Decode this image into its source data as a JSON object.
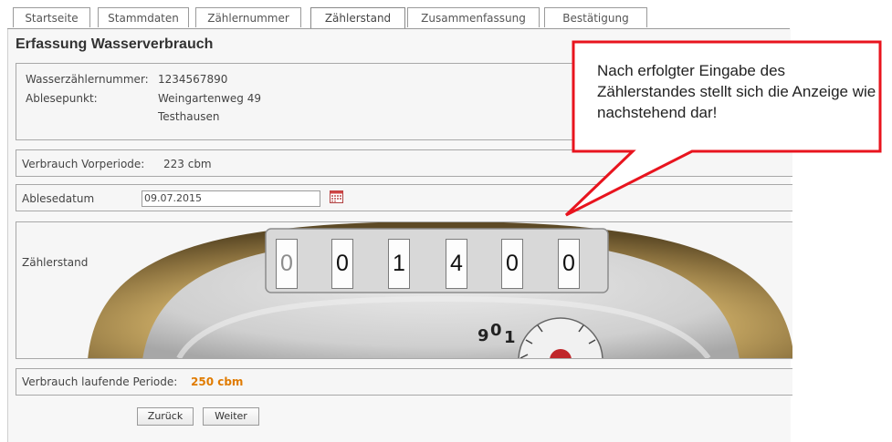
{
  "tabs": [
    "Startseite",
    "Stammdaten",
    "Zählernummer",
    "Zählerstand",
    "Zusammenfassung",
    "Bestätigung"
  ],
  "active_tab": "Zählerstand",
  "page_title": "Erfassung Wasserverbrauch",
  "meter_info": {
    "number_label": "Wasserzählernummer:",
    "number_value": "1234567890",
    "point_label": "Ablesepunkt:",
    "street": "Weingartenweg 49",
    "city": "Testhausen"
  },
  "previous_usage": {
    "label": "Verbrauch Vorperiode:",
    "value": "223 cbm"
  },
  "reading_date": {
    "label": "Ablesedatum",
    "value": "09.07.2015",
    "icon": "calendar-icon"
  },
  "meter_reading": {
    "label": "Zählerstand",
    "digits": [
      "0",
      "0",
      "1",
      "4",
      "0",
      "0"
    ],
    "dial_numbers": [
      "9",
      "0",
      "1"
    ]
  },
  "current_usage": {
    "label": "Verbrauch laufende Periode:",
    "value": "250 cbm",
    "value_color": "#e07b00"
  },
  "buttons": {
    "back": "Zurück",
    "next": "Weiter"
  },
  "callout": {
    "text": "Nach erfolgter Eingabe des Zählerstandes stellt sich die Anzeige wie nachstehend dar!",
    "border_color": "#e8141e"
  }
}
